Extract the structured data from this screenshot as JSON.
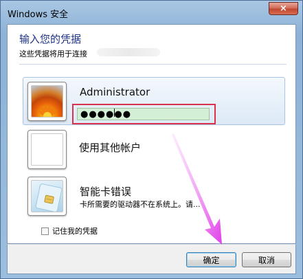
{
  "window": {
    "title": "Windows 安全",
    "close_label": "×"
  },
  "dialog": {
    "heading": "输入您的凭据",
    "subheading": "这些凭据将用于连接"
  },
  "tiles": [
    {
      "name": "Administrator",
      "password_value": "●●●●●●",
      "selected": true,
      "avatar_icon": "flower-avatar-icon"
    },
    {
      "name": "使用其他帐户",
      "avatar_icon": "blank-avatar-icon"
    },
    {
      "name": "智能卡错误",
      "description": "卡所需要的驱动器不在系统上。请...",
      "avatar_icon": "smart-card-icon"
    }
  ],
  "remember": {
    "label": "记住我的凭据",
    "checked": false
  },
  "buttons": {
    "ok": "确定",
    "cancel": "取消"
  },
  "annotation": {
    "arrow_color": "#e040e8",
    "highlight_color": "#d9324a"
  }
}
